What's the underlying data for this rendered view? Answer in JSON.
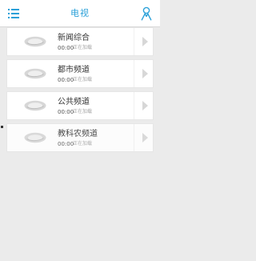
{
  "header": {
    "title": "电视",
    "menu_icon": "menu-icon",
    "user_icon": "user-icon",
    "accent_color": "#2aa0d8"
  },
  "channels": [
    {
      "name": "新闻综合",
      "time": "00:00",
      "status": "正在加载",
      "logo_icon": "channel-logo-icon",
      "action_icon": "play-icon"
    },
    {
      "name": "都市频道",
      "time": "00:00",
      "status": "正在加载",
      "logo_icon": "channel-logo-icon",
      "action_icon": "play-icon"
    },
    {
      "name": "公共频道",
      "time": "00:00",
      "status": "正在加载",
      "logo_icon": "channel-logo-icon",
      "action_icon": "play-icon"
    },
    {
      "name": "教科农频道",
      "time": "00:00",
      "status": "正在加载",
      "logo_icon": "channel-logo-icon",
      "action_icon": "play-icon"
    }
  ]
}
